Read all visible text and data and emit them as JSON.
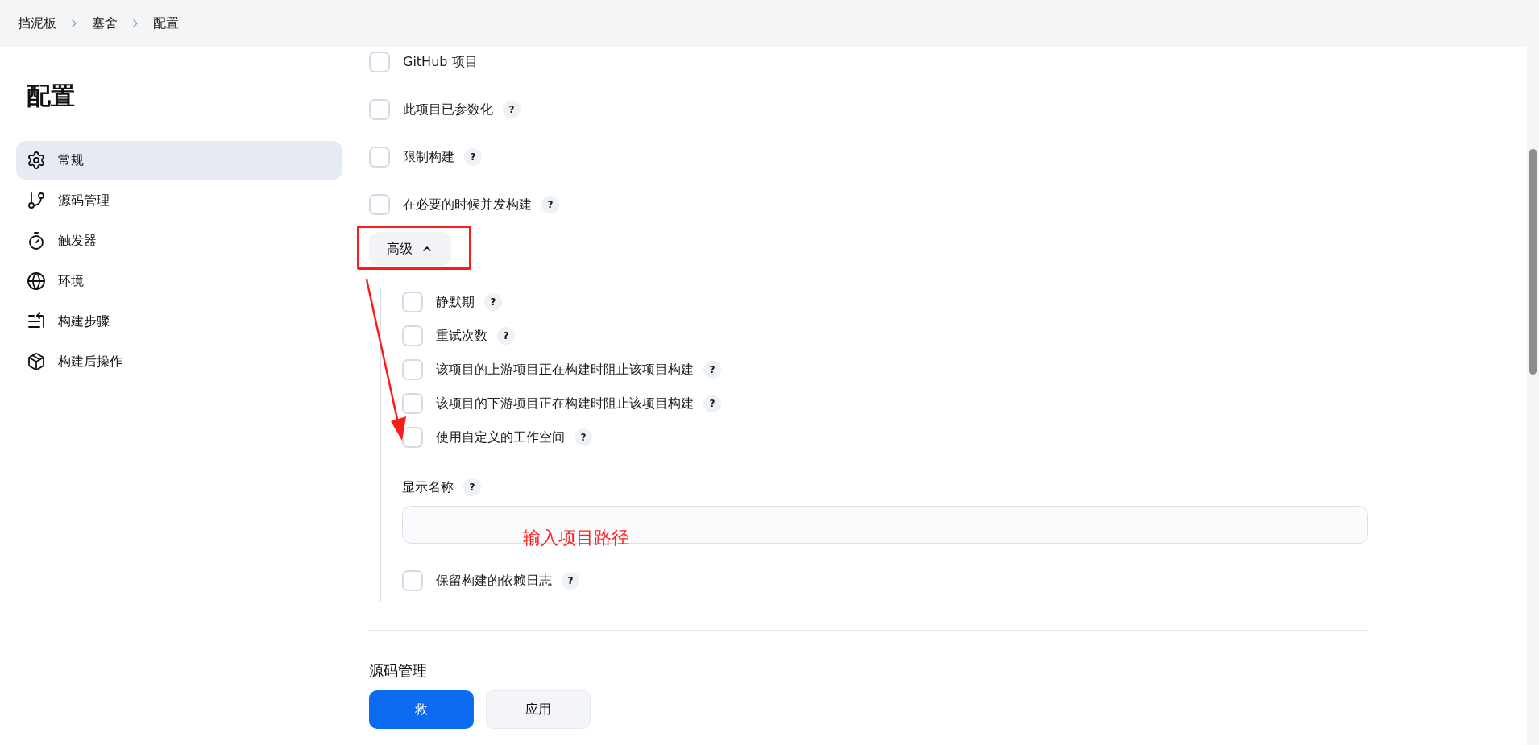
{
  "breadcrumbs": [
    {
      "label": "挡泥板"
    },
    {
      "label": "塞舍"
    },
    {
      "label": "配置"
    }
  ],
  "sidebar": {
    "title": "配置",
    "items": [
      {
        "label": "常规",
        "selected": true
      },
      {
        "label": "源码管理",
        "selected": false
      },
      {
        "label": "触发器",
        "selected": false
      },
      {
        "label": "环境",
        "selected": false
      },
      {
        "label": "构建步骤",
        "selected": false
      },
      {
        "label": "构建后操作",
        "selected": false
      }
    ]
  },
  "options": [
    {
      "label": "GitHub 项目",
      "checked": false
    },
    {
      "label": "此项目已参数化",
      "help": "?",
      "checked": false
    },
    {
      "label": "限制构建",
      "help": "?",
      "checked": false
    },
    {
      "label": "在必要的时候并发构建",
      "help": "?",
      "checked": false
    }
  ],
  "advanced": {
    "button": "高级",
    "expanded": true,
    "options": [
      {
        "label": "静默期",
        "help": "?",
        "checked": false
      },
      {
        "label": "重试次数",
        "help": "?",
        "checked": false
      },
      {
        "label": "该项目的上游项目正在构建时阻止该项目构建",
        "help": "?",
        "checked": false
      },
      {
        "label": "该项目的下游项目正在构建时阻止该项目构建",
        "help": "?",
        "checked": false
      },
      {
        "label": "使用自定义的工作空间",
        "help": "?",
        "checked": false
      }
    ],
    "display_name": {
      "label": "显示名称",
      "help": "?"
    },
    "annotation": "输入项目路径",
    "retain_option": {
      "label": "保留构建的依赖日志",
      "help": "?",
      "checked": false
    }
  },
  "section": {
    "title": "源码管理"
  },
  "buttons": {
    "save": "救",
    "apply": "应用"
  }
}
